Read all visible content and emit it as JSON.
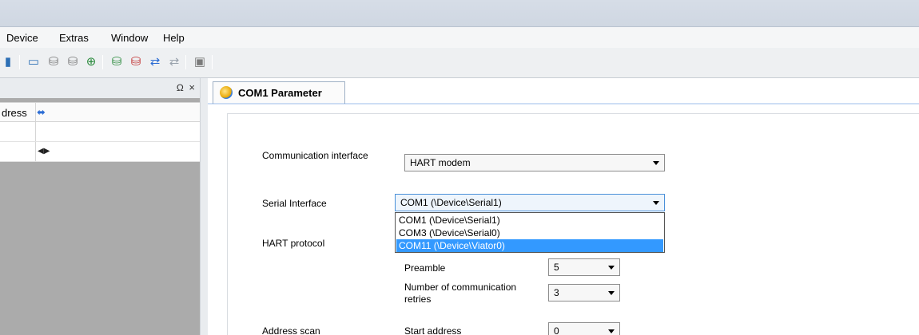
{
  "menu": [
    "Device",
    "Extras",
    "Window",
    "Help"
  ],
  "toolbar_icons": [
    "open-icon",
    "list-view-icon",
    "device-connect-icon",
    "device-disconnect-icon",
    "upload-icon",
    "device-add-icon",
    "device-remove-icon",
    "scan-icon",
    "scan-disabled-icon",
    "image-icon"
  ],
  "left_panel": {
    "pin_glyph": "Ω",
    "close_glyph": "×",
    "column_label": "dress",
    "column_icon_glyph": "⬌",
    "row_icon_glyph": "◀▶"
  },
  "tab": {
    "label": "COM1 Parameter"
  },
  "form": {
    "comm_interface_label": "Communication interface",
    "comm_interface_value": "HART modem",
    "serial_interface_label": "Serial Interface",
    "serial_interface_value": "COM1 (\\Device\\Serial1)",
    "hart_protocol_label": "HART protocol",
    "preamble_label": "Preamble",
    "preamble_value": "5",
    "retries_label_line1": "Number of communication",
    "retries_label_line2": "retries",
    "retries_value": "3",
    "address_scan_label": "Address scan",
    "start_address_label": "Start address",
    "start_address_value": "0"
  },
  "serial_options": [
    {
      "label": "COM1 (\\Device\\Serial1)",
      "selected": false
    },
    {
      "label": "COM3 (\\Device\\Serial0)",
      "selected": false
    },
    {
      "label": "COM11 (\\Device\\Viator0)",
      "selected": true
    }
  ],
  "colors": {
    "selection": "#3399ff",
    "panel_gray": "#ababab",
    "accent_blue": "#3b7dd8"
  }
}
